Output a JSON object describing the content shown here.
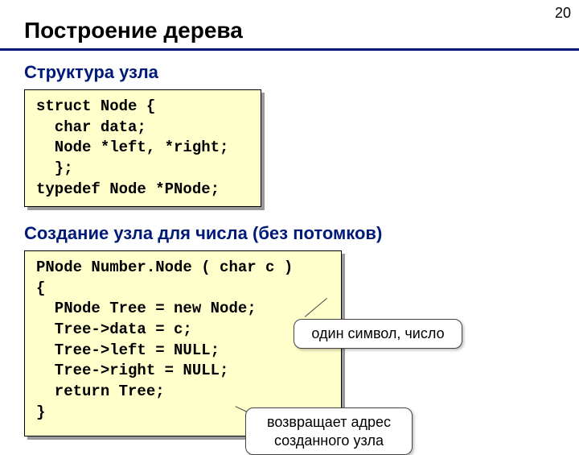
{
  "page_number": "20",
  "title": "Построение дерева",
  "section1": {
    "heading": "Структура узла",
    "code": "struct Node {\n  char data;\n  Node *left, *right;\n  };\ntypedef Node *PNode;"
  },
  "section2": {
    "heading": "Создание узла для числа (без потомков)",
    "code": "PNode Number.Node ( char c )\n{\n  PNode Tree = new Node;\n  Tree->data = c;\n  Tree->left = NULL;\n  Tree->right = NULL;\n  return Tree;\n}",
    "callout1": "один символ, число",
    "callout2": "возвращает адрес\nсозданного узла"
  }
}
